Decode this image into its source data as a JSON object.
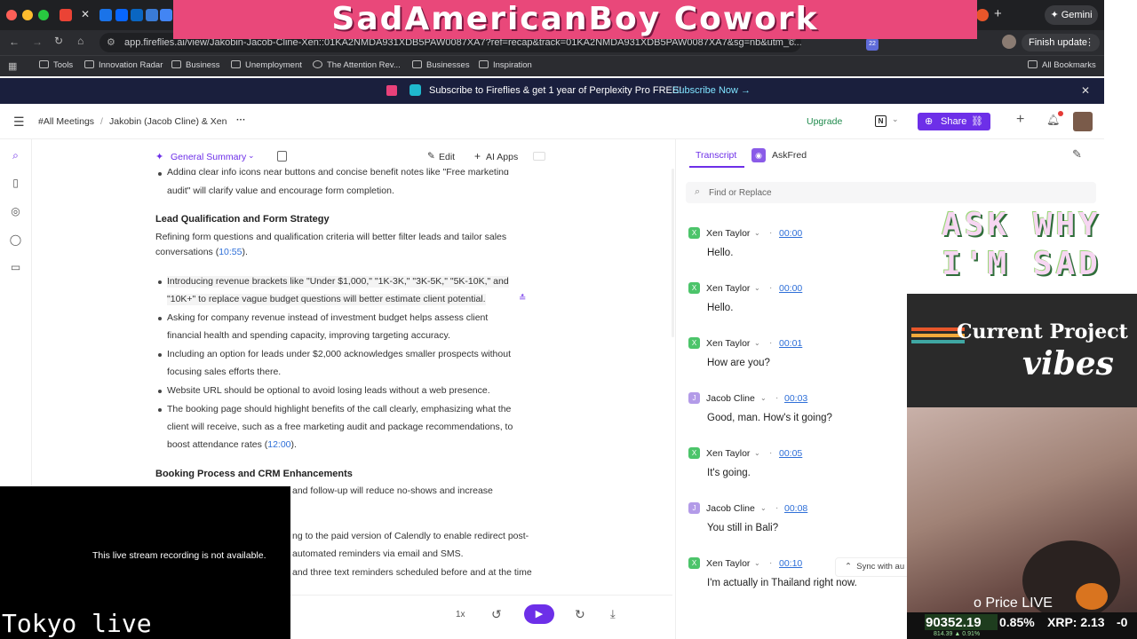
{
  "overlay": {
    "title": "SadAmericanBoy Cowork",
    "ask_line1": "ASK WHY",
    "ask_line2": "I'M SAD",
    "project_line1": "Current Project",
    "project_line2": "vibes",
    "stream_unavailable": "This live stream recording is not available.",
    "stream_caption": "Tokyo live",
    "price_live": "o Price LIVE",
    "ticker_value": "90352.19",
    "ticker_pct": "0.85%",
    "ticker_xrp": "XRP: 2.13",
    "ticker_trail": "-0",
    "ticker_sub": "814.39 ▲ 0.91%",
    "sync": "Sync with au"
  },
  "browser": {
    "gemini": "Gemini",
    "url": "app.fireflies.ai/view/Jakobin-Jacob-Cline-Xen::01KA2NMDA931XDB5PAW0087XA7?ref=recap&track=01KA2NMDA931XDB5PAW0087XA7&sg=nb&utm_c...",
    "finish_update": "Finish update",
    "bookmarks": [
      "Tools",
      "Innovation Radar",
      "Business",
      "Unemployment",
      "The Attention Rev...",
      "Businesses",
      "Inspiration"
    ],
    "all_bookmarks": "All Bookmarks",
    "badge": "22"
  },
  "banner": {
    "text": "Subscribe to Fireflies & get 1 year of Perplexity Pro FREE!",
    "cta": "Subscribe Now →"
  },
  "header": {
    "crumb1": "#All Meetings",
    "sep": "/",
    "crumb2": "Jakobin (Jacob Cline) & Xen",
    "more": "···",
    "upgrade": "Upgrade",
    "share": "Share"
  },
  "summary": {
    "dropdown": "General Summary",
    "edit": "Edit",
    "ai_apps": "AI Apps",
    "cutoff_line1": "Adding clear info icons near buttons and concise benefit notes like \"Free marketing",
    "cutoff_line2": "audit\" will clarify value and encourage form completion.",
    "section1_title": "Lead Qualification and Form Strategy",
    "section1_intro1": "Refining form questions and qualification criteria will better filter leads and tailor sales",
    "section1_intro2": "conversations (",
    "section1_intro_time": "10:55",
    "section1_intro_end": ").",
    "b1_l1": "Introducing revenue brackets like \"Under $1,000,\" \"1K-3K,\" \"3K-5K,\" \"5K-10K,\" and",
    "b1_l2": "\"10K+\" to replace vague budget questions will better estimate client potential.",
    "b2_l1": "Asking for company revenue instead of investment budget helps assess client",
    "b2_l2": "financial health and spending capacity, improving targeting accuracy.",
    "b3_l1": "Including an option for leads under $2,000 acknowledges smaller prospects without",
    "b3_l2": "focusing sales efforts there.",
    "b4_l1": "Website URL should be optional to avoid losing leads without a web presence.",
    "b5_l1": "The booking page should highlight benefits of the call clearly, emphasizing what the",
    "b5_l2": "client will receive, such as a free marketing audit and package recommendations, to",
    "b5_l3": "boost attendance rates (",
    "b5_time": "12:00",
    "b5_end": ").",
    "section2_title": "Booking Process and CRM Enhancements",
    "s2_frag1": "and follow-up will reduce no-shows and increase",
    "s2_frag2": "ng to the paid version of Calendly to enable redirect post-",
    "s2_frag3": "automated reminders via email and SMS.",
    "s2_frag4": "and three text reminders scheduled before and at the time"
  },
  "player": {
    "speed": "1x"
  },
  "transcript": {
    "tab_transcript": "Transcript",
    "tab_askfred": "AskFred",
    "search_placeholder": "Find or Replace",
    "entries": [
      {
        "speaker": "Xen Taylor",
        "initial": "X",
        "time": "00:00",
        "text": "Hello."
      },
      {
        "speaker": "Xen Taylor",
        "initial": "X",
        "time": "00:00",
        "text": "Hello."
      },
      {
        "speaker": "Xen Taylor",
        "initial": "X",
        "time": "00:01",
        "text": "How are you?"
      },
      {
        "speaker": "Jacob Cline",
        "initial": "J",
        "time": "00:03",
        "text": "Good, man. How's it going?"
      },
      {
        "speaker": "Xen Taylor",
        "initial": "X",
        "time": "00:05",
        "text": "It's going."
      },
      {
        "speaker": "Jacob Cline",
        "initial": "J",
        "time": "00:08",
        "text": "You still in Bali?"
      },
      {
        "speaker": "Xen Taylor",
        "initial": "X",
        "time": "00:10",
        "text": "I'm actually in Thailand right now."
      }
    ]
  },
  "colors": {
    "accent": "#6d2fe8",
    "link": "#2e6fd8",
    "xen": "#4cc46a",
    "jacob": "#b39be8",
    "upgrade": "#1f8a4c",
    "title_bg": "#e9487a"
  }
}
